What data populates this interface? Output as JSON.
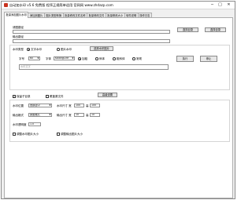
{
  "window": {
    "title": "自动加水印 v5.6 免费版 程序正规简单适用 官网网 www.zhdazp.com",
    "minimize": "─",
    "maximize": "□",
    "close": "✕"
  },
  "tabs": [
    "批量添加图片水印",
    "添加到图片",
    "图片类型转换",
    "批量修改文件名称",
    "批量修改文件",
    "批量修改大小",
    "软件说明",
    "操作日志"
  ],
  "files": {
    "image_path_label": "请图路径",
    "output_path_label": "输出路径",
    "source_button": "选择目录",
    "output_button": "选择目录"
  },
  "watermark": {
    "type_label": "水印类型",
    "type_text": "文字水印",
    "type_image": "图片水印",
    "choose_image_button": "选择水印图片",
    "font_size_label": "字号",
    "font_size_value": "60",
    "font_label": "字体",
    "font_value": "KaiangChe",
    "style_normal": "加粗",
    "style_italic": "斜体",
    "style_bold": "粗斜体",
    "style_regular": "常规",
    "text_placeholder": "水印文字",
    "run_button": "执行",
    "stop_button": "停止"
  },
  "options": {
    "keep_source_label": "保留子目录",
    "overwrite_label": "覆盖原文件",
    "advanced_button": "高级设置"
  },
  "position": {
    "pos_label": "水印位置",
    "pos_value": "底部居中",
    "offset_label": "水印尺寸 宽",
    "width_value": "100",
    "height_label": "高",
    "height_value": "100",
    "output_label": "输出格式",
    "output_value": "原图格式",
    "margin_label": "输出尺寸 宽",
    "margin_value": "10",
    "margin_h_label": "高",
    "margin_h_value": "10",
    "opacity_label": "水印透明度",
    "opacity_value": "1.0",
    "auto_size_label": "调整水印图片大小",
    "auto_out_label": "调整输出图片大小"
  }
}
